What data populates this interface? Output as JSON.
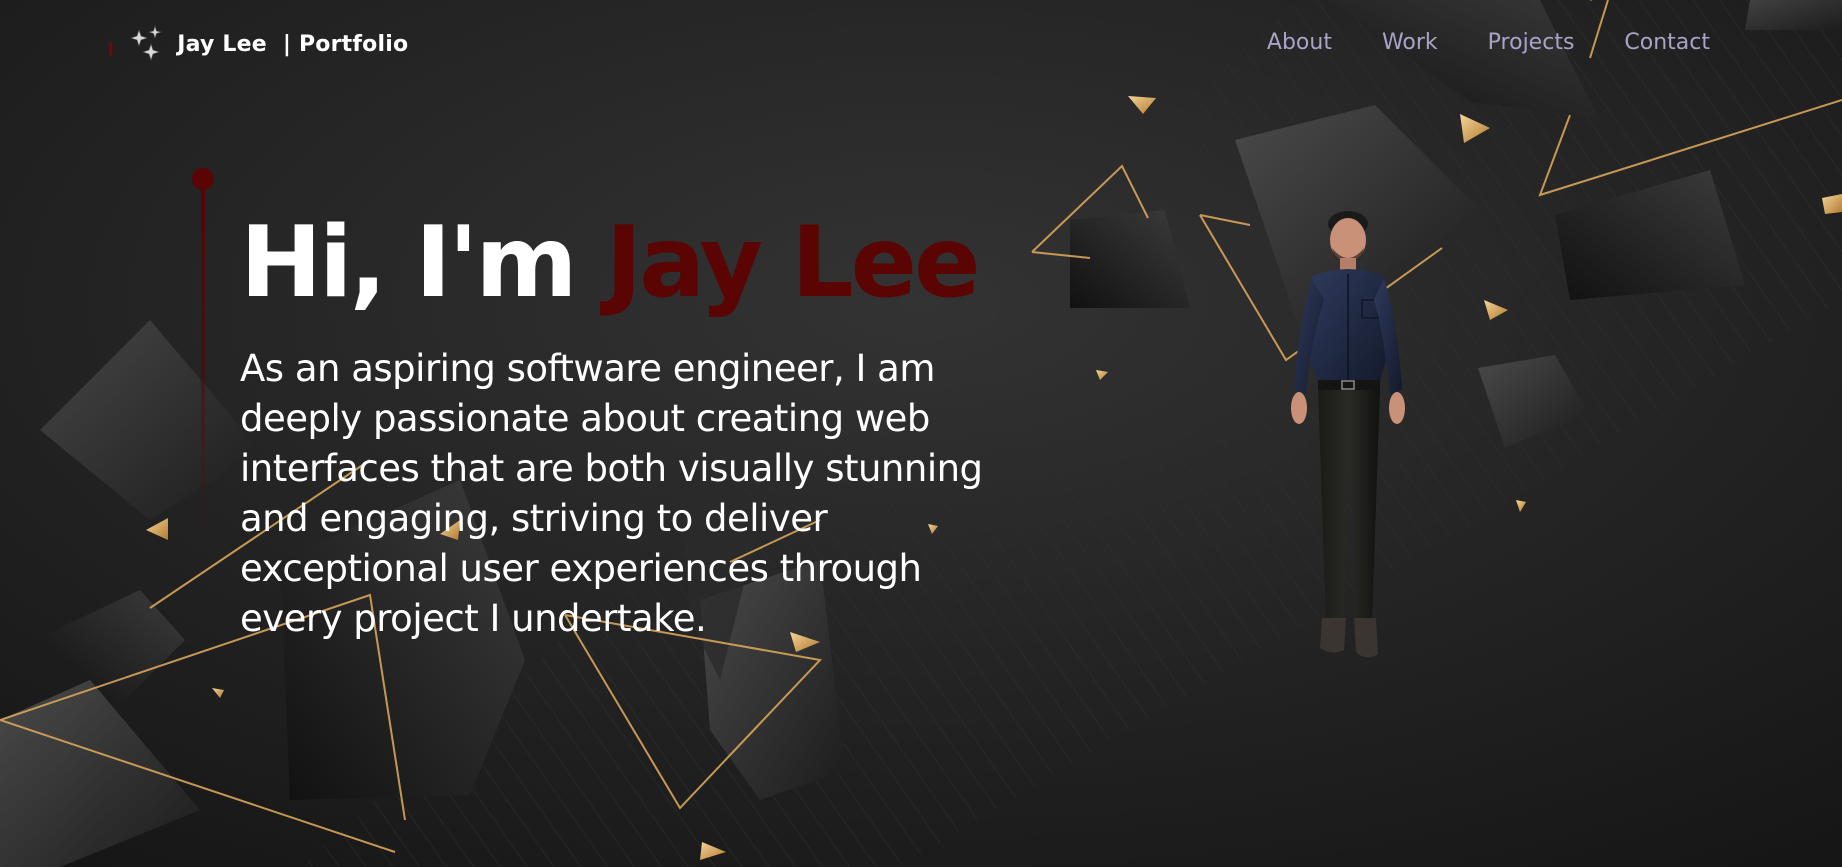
{
  "brand": {
    "name": "Jay Lee",
    "subtitle": "| Portfolio",
    "mark_icon": "pin-icon",
    "logo_icon": "shuriken-stars-icon"
  },
  "nav": {
    "items": [
      {
        "label": "About"
      },
      {
        "label": "Work"
      },
      {
        "label": "Projects"
      },
      {
        "label": "Contact"
      }
    ]
  },
  "hero": {
    "greeting": "Hi, I'm ",
    "name": "Jay Lee",
    "description": "As an aspiring software engineer, I am deeply passionate about creating web interfaces that are both visually stunning and engaging, striving to deliver exceptional user experiences through every project I undertake."
  },
  "avatar": {
    "icon": "3d-avatar-figure"
  },
  "colors": {
    "background": "#1b1b1b",
    "accent_name": "#5a0404",
    "nav_link": "#a9a3c7",
    "gold": "#d8a85a",
    "text": "#ffffff"
  }
}
